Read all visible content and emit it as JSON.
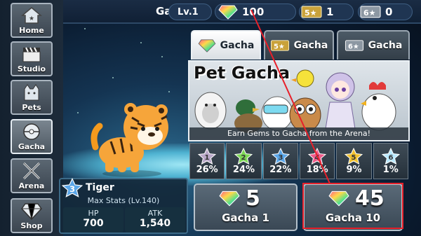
{
  "header": {
    "title": "Gacha",
    "level": "Lv.1",
    "gems": "100",
    "ticket5_count": "1",
    "ticket6_count": "0"
  },
  "sidebar": {
    "items": [
      {
        "label": "Home",
        "icon": "home-icon"
      },
      {
        "label": "Studio",
        "icon": "clapperboard-icon"
      },
      {
        "label": "Pets",
        "icon": "cat-icon"
      },
      {
        "label": "Gacha",
        "icon": "capsule-icon",
        "active": true
      },
      {
        "label": "Arena",
        "icon": "crossed-swords-icon"
      },
      {
        "label": "Shop",
        "icon": "gem-icon"
      }
    ]
  },
  "tabs": [
    {
      "label": "Gacha",
      "icon": "gem-icon",
      "active": true
    },
    {
      "label": "Gacha",
      "icon": "ticket-5-star-icon",
      "active": false
    },
    {
      "label": "Gacha",
      "icon": "ticket-6-star-icon",
      "active": false
    }
  ],
  "banner": {
    "title": "Pet Gacha",
    "caption": "Earn Gems to Gacha from the Arena!"
  },
  "rates": [
    {
      "stars": "1",
      "pct": "26%",
      "color": "#b9a8c9"
    },
    {
      "stars": "2",
      "pct": "24%",
      "color": "#7ed957"
    },
    {
      "stars": "3",
      "pct": "22%",
      "color": "#5aa6e8"
    },
    {
      "stars": "4",
      "pct": "18%",
      "color": "#ef5a8a"
    },
    {
      "stars": "5",
      "pct": "9%",
      "color": "#f2c230"
    },
    {
      "stars": "6",
      "pct": "1%",
      "color": "#b8e8ff"
    }
  ],
  "pet": {
    "rarity": "3",
    "name": "Tiger",
    "max_stats": "Max Stats (Lv.140)",
    "hp_label": "HP",
    "hp": "700",
    "atk_label": "ATK",
    "atk": "1,540"
  },
  "buttons": {
    "single": {
      "cost": "5",
      "label": "Gacha 1"
    },
    "ten": {
      "cost": "45",
      "label": "Gacha 10"
    }
  },
  "colors": {
    "highlight": "#e8202a",
    "accent": "#2d4866"
  }
}
